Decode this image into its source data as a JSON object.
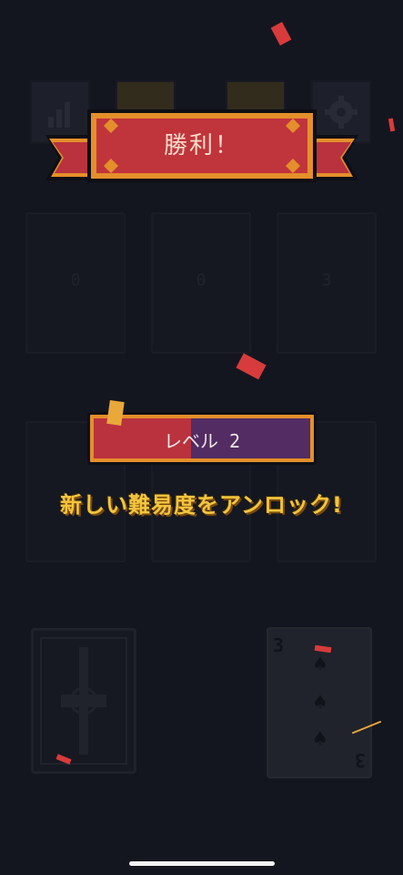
{
  "banner": {
    "title": "勝利！"
  },
  "level": {
    "label": "レベル 2",
    "progress": 0.45
  },
  "message": {
    "text": "新しい難易度をアンロック!"
  },
  "board": {
    "slot_labels": [
      "0",
      "0",
      "3"
    ],
    "discard_card": {
      "rank": "3",
      "suit": "spade"
    }
  },
  "colors": {
    "background": "#14161f",
    "banner_red": "#c0343c",
    "banner_orange": "#e48f2a",
    "level_purple": "#522c63",
    "message_gold": "#f3c53e"
  },
  "icons": [
    "stats-icon",
    "gear-icon",
    "spade-icon"
  ]
}
